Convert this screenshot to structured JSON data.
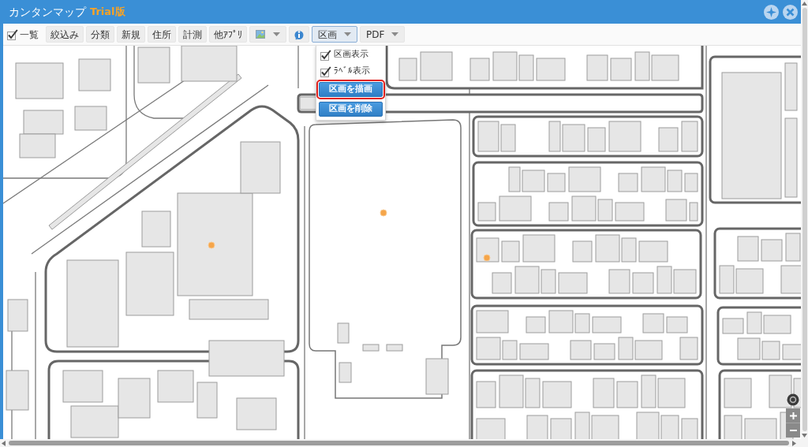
{
  "window": {
    "title": "カンタンマップ",
    "badge": "Trial版"
  },
  "toolbar": {
    "list_toggle": {
      "label": "一覧",
      "checked": true
    },
    "buttons": [
      {
        "kind": "text",
        "label": "絞込み"
      },
      {
        "kind": "text",
        "label": "分類"
      },
      {
        "kind": "text",
        "label": "新規"
      },
      {
        "kind": "text",
        "label": "住所"
      },
      {
        "kind": "text",
        "label": "計測"
      },
      {
        "kind": "text",
        "label": "他ｱﾌﾟﾘ"
      },
      {
        "kind": "image_dropdown"
      },
      {
        "kind": "info"
      },
      {
        "kind": "dropdown",
        "label": "区画",
        "selected": true
      },
      {
        "kind": "dropdown",
        "label": "PDF",
        "selected": false
      }
    ]
  },
  "dropdown_menu": {
    "items": [
      {
        "kind": "check",
        "label": "区画表示",
        "checked": true
      },
      {
        "kind": "check",
        "label": "ﾗﾍﾞﾙ表示",
        "checked": true
      },
      {
        "kind": "button",
        "label": "区画を描画",
        "selected": true
      },
      {
        "kind": "button",
        "label": "区画を削除",
        "selected": false
      }
    ]
  }
}
